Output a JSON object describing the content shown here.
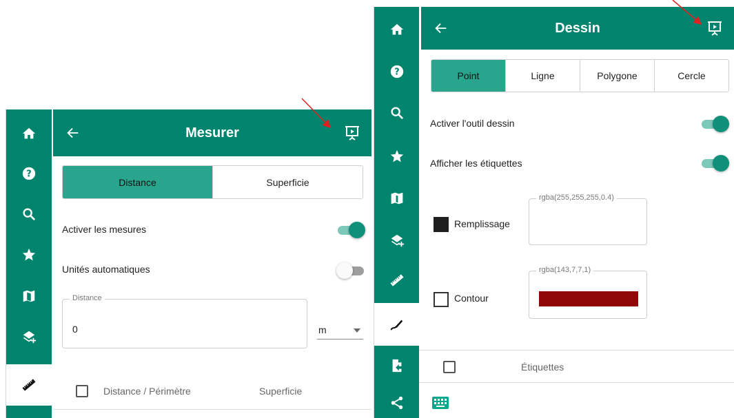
{
  "colors": {
    "primary": "#00846d",
    "active_segment": "#2aa58d",
    "contour": "#8f0707",
    "annotation_arrow": "#e02020"
  },
  "measure_panel": {
    "title": "Mesurer",
    "tabs": [
      {
        "label": "Distance",
        "active": true
      },
      {
        "label": "Superficie",
        "active": false
      }
    ],
    "enable_measures": {
      "label": "Activer les mesures",
      "on": true
    },
    "auto_units": {
      "label": "Unités automatiques",
      "on": false
    },
    "distance_field": {
      "legend": "Distance",
      "value": "0"
    },
    "unit_select": {
      "value": "m"
    },
    "table_headers": {
      "col1": "Distance / Périmètre",
      "col2": "Superficie"
    },
    "rail_icons": [
      "home-icon",
      "help-icon",
      "search-icon",
      "star-icon",
      "map-icon",
      "layers-add-icon",
      "ruler-icon"
    ]
  },
  "draw_panel": {
    "title": "Dessin",
    "tabs": [
      {
        "label": "Point",
        "active": true
      },
      {
        "label": "Ligne",
        "active": false
      },
      {
        "label": "Polygone",
        "active": false
      },
      {
        "label": "Cercle",
        "active": false
      }
    ],
    "enable_draw": {
      "label": "Activer l'outil dessin",
      "on": true
    },
    "show_labels": {
      "label": "Afficher les étiquettes",
      "on": true
    },
    "fill": {
      "label": "Remplissage",
      "legend": "rgba(255,255,255,0.4)"
    },
    "contour": {
      "label": "Contour",
      "legend": "rgba(143,7,7,1)"
    },
    "labels_header": "Étiquettes",
    "rail_icons": [
      "home-icon",
      "help-icon",
      "search-icon",
      "star-icon",
      "map-icon",
      "layers-add-icon",
      "ruler-icon",
      "draw-icon",
      "file-export-icon",
      "share-icon"
    ]
  }
}
